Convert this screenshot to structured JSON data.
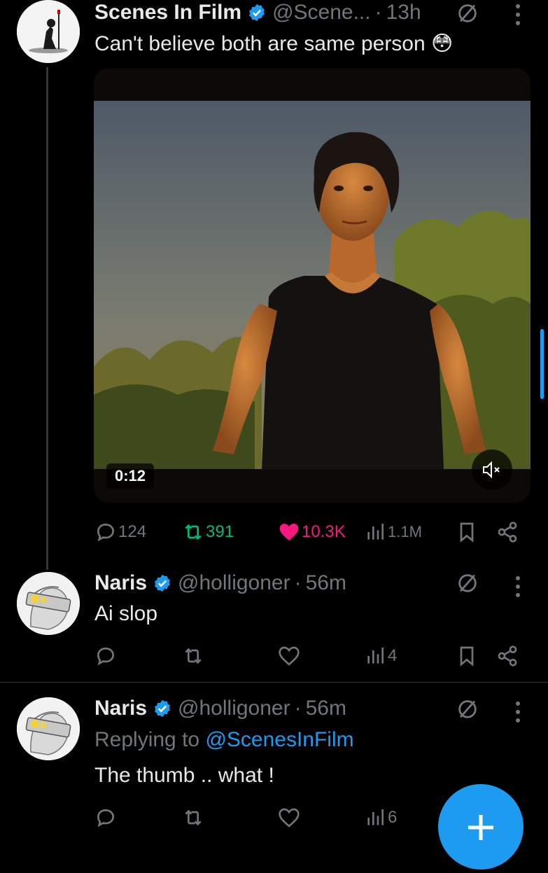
{
  "posts": [
    {
      "name": "Scenes In Film",
      "handle": "@Scene...",
      "sep": "·",
      "time": "13h",
      "text": "Can't believe both are same person",
      "emoji": "😳",
      "video_duration": "0:12",
      "replies": "124",
      "reposts": "391",
      "likes": "10.3K",
      "views": "1.1M",
      "liked": true,
      "reposted": true
    },
    {
      "name": "Naris",
      "handle": "@holligoner",
      "sep": "·",
      "time": "56m",
      "text": "Ai slop",
      "views": "4"
    },
    {
      "name": "Naris",
      "handle": "@holligoner",
      "sep": "·",
      "time": "56m",
      "replying_prefix": "Replying to",
      "replying_handle": "@ScenesInFilm",
      "text": "The thumb .. what !",
      "views": "6"
    }
  ],
  "colors": {
    "accent": "#1d9bf0",
    "like": "#f91880",
    "repost": "#00ba7c",
    "muted": "#71767b",
    "background": "#000000"
  },
  "icons": [
    "reply-icon",
    "repost-icon",
    "like-icon",
    "views-icon",
    "bookmark-icon",
    "share-icon",
    "grok-icon",
    "more-icon",
    "mute-icon",
    "compose-icon"
  ]
}
